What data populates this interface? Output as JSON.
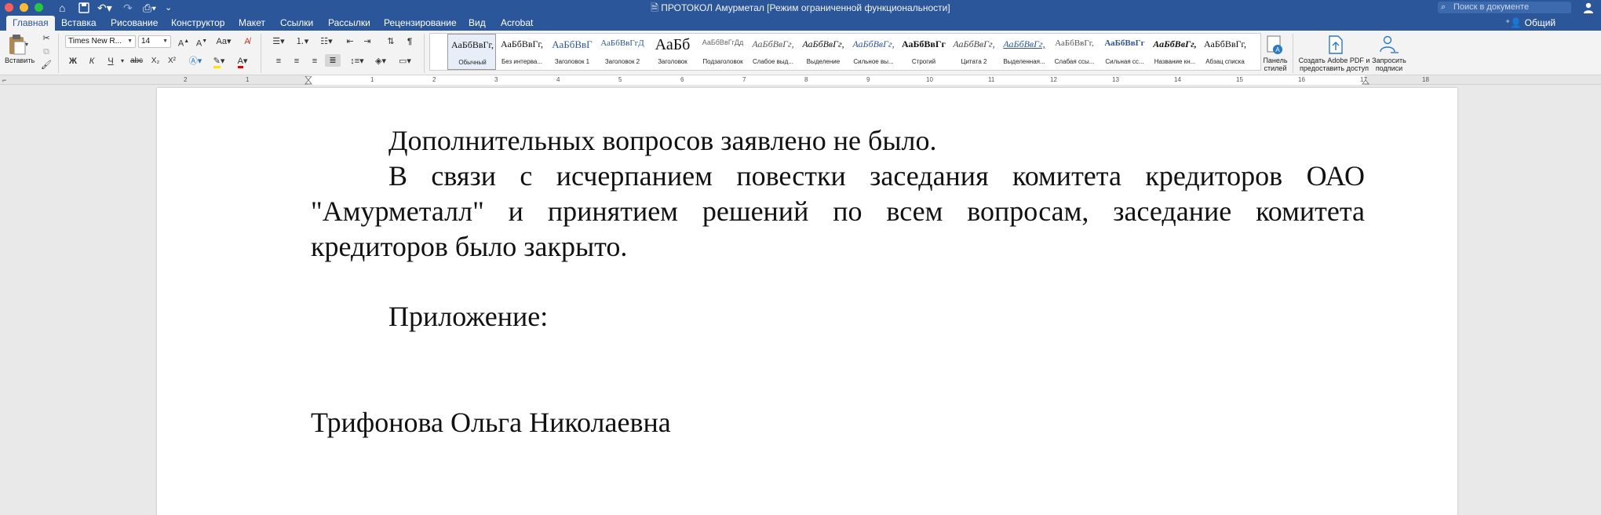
{
  "window": {
    "title": "ПРОТОКОЛ Амурметал [Режим ограниченной функциональности]"
  },
  "titlebar": {
    "search_placeholder": "Поиск в документе"
  },
  "tabs": [
    {
      "label": "Главная",
      "active": true
    },
    {
      "label": "Вставка"
    },
    {
      "label": "Рисование"
    },
    {
      "label": "Конструктор"
    },
    {
      "label": "Макет"
    },
    {
      "label": "Ссылки"
    },
    {
      "label": "Рассылки"
    },
    {
      "label": "Рецензирование"
    },
    {
      "label": "Вид"
    },
    {
      "label": "Acrobat"
    }
  ],
  "share": {
    "label": "Общий доступ"
  },
  "ribbon": {
    "paste_label": "Вставить",
    "font_name": "Times New R...",
    "font_size": "14",
    "bold": "Ж",
    "italic": "К",
    "underline": "Ч",
    "strike": "abc",
    "subscript": "X₂",
    "superscript": "X²",
    "styles": [
      {
        "sample": "АаБбВвГг,",
        "name": "Обычный",
        "selected": true
      },
      {
        "sample": "АаБбВвГг,",
        "name": "Без интерва..."
      },
      {
        "sample": "АаБбВвГ",
        "name": "Заголовок 1"
      },
      {
        "sample": "АаБбВвГгД",
        "name": "Заголовок 2"
      },
      {
        "sample": "АаБб",
        "name": "Заголовок"
      },
      {
        "sample": "АаБбВвГгДд",
        "name": "Подзаголовок"
      },
      {
        "sample": "АаБбВвГг,",
        "name": "Слабое выд..."
      },
      {
        "sample": "АаБбВвГг,",
        "name": "Выделение"
      },
      {
        "sample": "АаБбВвГг,",
        "name": "Сильное вы..."
      },
      {
        "sample": "АаБбВвГг",
        "name": "Строгий"
      },
      {
        "sample": "АаБбВвГг,",
        "name": "Цитата 2"
      },
      {
        "sample": "АаБбВвГг,",
        "name": "Выделенная..."
      },
      {
        "sample": "АаБбВвГг,",
        "name": "Слабая ссы..."
      },
      {
        "sample": "АаБбВвГг",
        "name": "Сильная сс..."
      },
      {
        "sample": "АаБбВвГг,",
        "name": "Название кн..."
      },
      {
        "sample": "АаБбВвГг,",
        "name": "Абзац списка"
      }
    ],
    "styles_pane": {
      "line1": "Панель",
      "line2": "стилей"
    },
    "adobe_pdf": {
      "line1": "Создать Adobe PDF и",
      "line2": "предоставить доступ"
    },
    "request_sign": {
      "line1": "Запросить",
      "line2": "подписи"
    }
  },
  "ruler": {
    "numbers": [
      "2",
      "1",
      "1",
      "2",
      "3",
      "4",
      "5",
      "6",
      "7",
      "8",
      "9",
      "10",
      "11",
      "12",
      "13",
      "14",
      "15",
      "16",
      "17",
      "18"
    ]
  },
  "document": {
    "p1": "Дополнительных вопросов заявлено не было.",
    "p2": "В связи с исчерпанием повестки заседания комитета кредиторов ОАО \"Амурметалл\" и принятием решений по всем вопросам, заседание комитета кредиторов было закрыто.",
    "p3": "Приложение:",
    "p4": "Трифонова Ольга Николаевна"
  }
}
